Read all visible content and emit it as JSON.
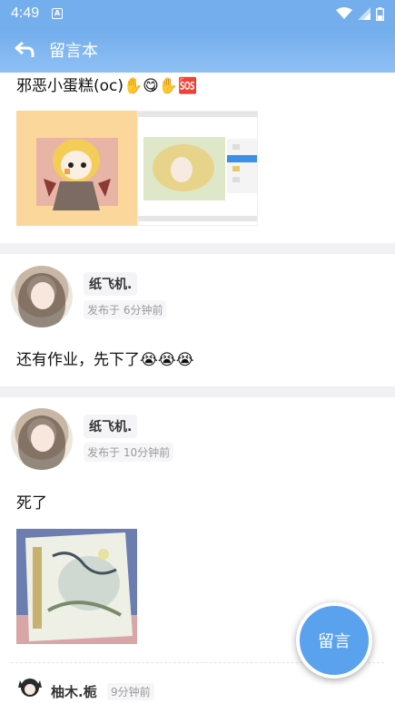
{
  "status_bar": {
    "time": "4:49",
    "notification_icon": "A"
  },
  "app_bar": {
    "title": "留言本",
    "back_icon": "back-arrow-icon"
  },
  "posts": [
    {
      "text": "邪恶小蛋糕(oc)✋😋✋🆘",
      "images": [
        "chibi-character-art",
        "drawing-app-screenshot"
      ]
    },
    {
      "username": "纸飞机.",
      "time": "发布于 6分钟前",
      "text": "还有作业，先下了😭😭😭"
    },
    {
      "username": "纸飞机.",
      "time": "发布于 10分钟前",
      "text": "死了",
      "images": [
        "homework-drawing-photo"
      ]
    },
    {
      "username": "柚木.栀",
      "time": "9分钟前"
    }
  ],
  "fab": {
    "label": "留言"
  },
  "colors": {
    "accent": "#74aeec",
    "fab": "#5aa2ee",
    "separator": "#f1f1f3"
  }
}
